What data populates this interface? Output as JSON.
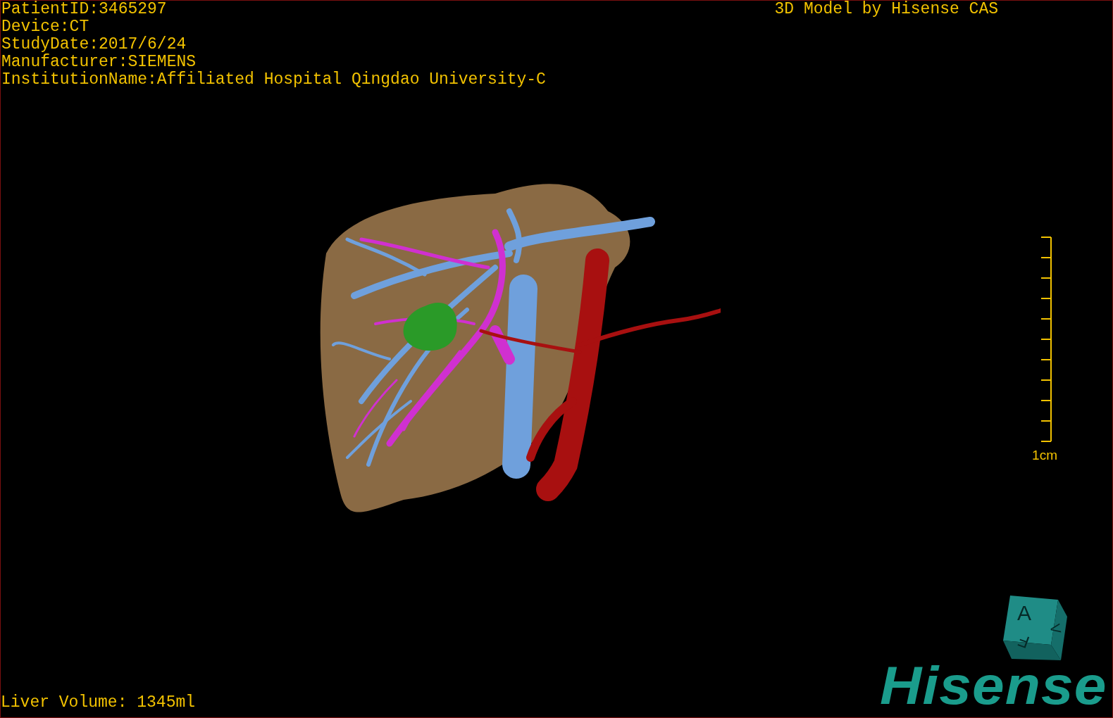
{
  "patient_info": [
    "PatientID:3465297",
    "Device:CT",
    "StudyDate:2017/6/24",
    "Manufacturer:SIEMENS",
    "InstitutionName:Affiliated Hospital Qingdao University-C"
  ],
  "title": "3D Model by Hisense CAS",
  "scale_bar": {
    "label": "1cm"
  },
  "orientation_cube": {
    "faces": [
      "A",
      "F",
      "V"
    ]
  },
  "liver_volume": "Liver Volume: 1345ml",
  "logo": "Hisense"
}
